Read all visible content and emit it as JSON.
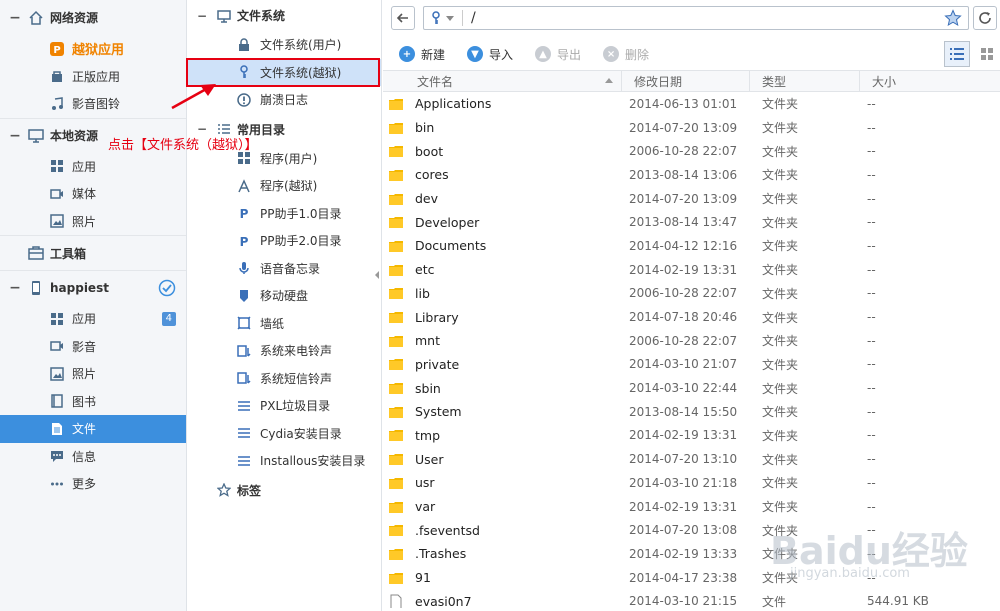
{
  "sidebar": {
    "sections": [
      {
        "title": "网络资源",
        "icon": "home-icon",
        "items": [
          {
            "label": "越狱应用",
            "icon": "pp-icon"
          },
          {
            "label": "正版应用",
            "icon": "app-store-icon"
          },
          {
            "label": "影音图铃",
            "icon": "music-icon"
          }
        ]
      },
      {
        "title": "本地资源",
        "icon": "monitor-icon",
        "items": [
          {
            "label": "应用",
            "icon": "grid-icon"
          },
          {
            "label": "媒体",
            "icon": "video-icon"
          },
          {
            "label": "照片",
            "icon": "photo-icon"
          }
        ]
      },
      {
        "title": "工具箱",
        "icon": "toolbox-icon",
        "items": []
      },
      {
        "title": "happiest",
        "icon": "phone-icon",
        "items": [
          {
            "label": "应用",
            "icon": "grid-icon",
            "badge": "4"
          },
          {
            "label": "影音",
            "icon": "video-icon"
          },
          {
            "label": "照片",
            "icon": "photo-icon"
          },
          {
            "label": "图书",
            "icon": "book-icon"
          },
          {
            "label": "文件",
            "icon": "file-icon"
          },
          {
            "label": "信息",
            "icon": "message-icon"
          },
          {
            "label": "更多",
            "icon": "more-icon"
          }
        ]
      }
    ]
  },
  "tree": {
    "filesystem_title": "文件系统",
    "filesystem_items": [
      {
        "label": "文件系统(用户)",
        "icon": "lock-icon"
      },
      {
        "label": "文件系统(越狱)",
        "icon": "key-icon"
      },
      {
        "label": "崩溃日志",
        "icon": "crash-icon"
      }
    ],
    "common_title": "常用目录",
    "common_items": [
      {
        "label": "程序(用户)",
        "icon": "grid-icon"
      },
      {
        "label": "程序(越狱)",
        "icon": "cydia-icon"
      },
      {
        "label": "PP助手1.0目录",
        "icon": "pp-icon"
      },
      {
        "label": "PP助手2.0目录",
        "icon": "pp-icon"
      },
      {
        "label": "语音备忘录",
        "icon": "mic-icon"
      },
      {
        "label": "移动硬盘",
        "icon": "drive-icon"
      },
      {
        "label": "墙纸",
        "icon": "wallpaper-icon"
      },
      {
        "label": "系统来电铃声",
        "icon": "ringtone-icon"
      },
      {
        "label": "系统短信铃声",
        "icon": "ringtone-icon"
      },
      {
        "label": "PXL垃圾目录",
        "icon": "list-icon"
      },
      {
        "label": "Cydia安装目录",
        "icon": "list-icon"
      },
      {
        "label": "Installous安装目录",
        "icon": "list-icon"
      }
    ],
    "tags_title": "标签"
  },
  "annotation": {
    "text": "点击【文件系统（越狱）】"
  },
  "address": {
    "path": "/"
  },
  "toolbar": {
    "new_label": "新建",
    "import_label": "导入",
    "export_label": "导出",
    "delete_label": "删除"
  },
  "table": {
    "columns": [
      "文件名",
      "修改日期",
      "类型",
      "大小"
    ],
    "rows": [
      {
        "name": "Applications",
        "date": "2014-06-13 01:01",
        "type": "文件夹",
        "size": "--",
        "kind": "folder"
      },
      {
        "name": "bin",
        "date": "2014-07-20 13:09",
        "type": "文件夹",
        "size": "--",
        "kind": "folder"
      },
      {
        "name": "boot",
        "date": "2006-10-28 22:07",
        "type": "文件夹",
        "size": "--",
        "kind": "folder"
      },
      {
        "name": "cores",
        "date": "2013-08-14 13:06",
        "type": "文件夹",
        "size": "--",
        "kind": "folder"
      },
      {
        "name": "dev",
        "date": "2014-07-20 13:09",
        "type": "文件夹",
        "size": "--",
        "kind": "folder"
      },
      {
        "name": "Developer",
        "date": "2013-08-14 13:47",
        "type": "文件夹",
        "size": "--",
        "kind": "folder"
      },
      {
        "name": "Documents",
        "date": "2014-04-12 12:16",
        "type": "文件夹",
        "size": "--",
        "kind": "folder"
      },
      {
        "name": "etc",
        "date": "2014-02-19 13:31",
        "type": "文件夹",
        "size": "--",
        "kind": "folder"
      },
      {
        "name": "lib",
        "date": "2006-10-28 22:07",
        "type": "文件夹",
        "size": "--",
        "kind": "folder"
      },
      {
        "name": "Library",
        "date": "2014-07-18 20:46",
        "type": "文件夹",
        "size": "--",
        "kind": "folder"
      },
      {
        "name": "mnt",
        "date": "2006-10-28 22:07",
        "type": "文件夹",
        "size": "--",
        "kind": "folder"
      },
      {
        "name": "private",
        "date": "2014-03-10 21:07",
        "type": "文件夹",
        "size": "--",
        "kind": "folder"
      },
      {
        "name": "sbin",
        "date": "2014-03-10 22:44",
        "type": "文件夹",
        "size": "--",
        "kind": "folder"
      },
      {
        "name": "System",
        "date": "2013-08-14 15:50",
        "type": "文件夹",
        "size": "--",
        "kind": "folder"
      },
      {
        "name": "tmp",
        "date": "2014-02-19 13:31",
        "type": "文件夹",
        "size": "--",
        "kind": "folder"
      },
      {
        "name": "User",
        "date": "2014-07-20 13:10",
        "type": "文件夹",
        "size": "--",
        "kind": "folder"
      },
      {
        "name": "usr",
        "date": "2014-03-10 21:18",
        "type": "文件夹",
        "size": "--",
        "kind": "folder"
      },
      {
        "name": "var",
        "date": "2014-02-19 13:31",
        "type": "文件夹",
        "size": "--",
        "kind": "folder"
      },
      {
        "name": ".fseventsd",
        "date": "2014-07-20 13:08",
        "type": "文件夹",
        "size": "--",
        "kind": "folder"
      },
      {
        "name": ".Trashes",
        "date": "2014-02-19 13:33",
        "type": "文件夹",
        "size": "--",
        "kind": "folder"
      },
      {
        "name": "91",
        "date": "2014-04-17 23:38",
        "type": "文件夹",
        "size": "--",
        "kind": "folder"
      },
      {
        "name": "evasi0n7",
        "date": "2014-03-10 21:15",
        "type": "文件",
        "size": "544.91 KB",
        "kind": "file"
      }
    ]
  },
  "watermark": {
    "logo": "Baidu经验",
    "url": "jingyan.baidu.com"
  },
  "colors": {
    "accent": "#3c8fde",
    "orange": "#f08300",
    "annotation": "#e60012",
    "folder": "#f5b800"
  }
}
